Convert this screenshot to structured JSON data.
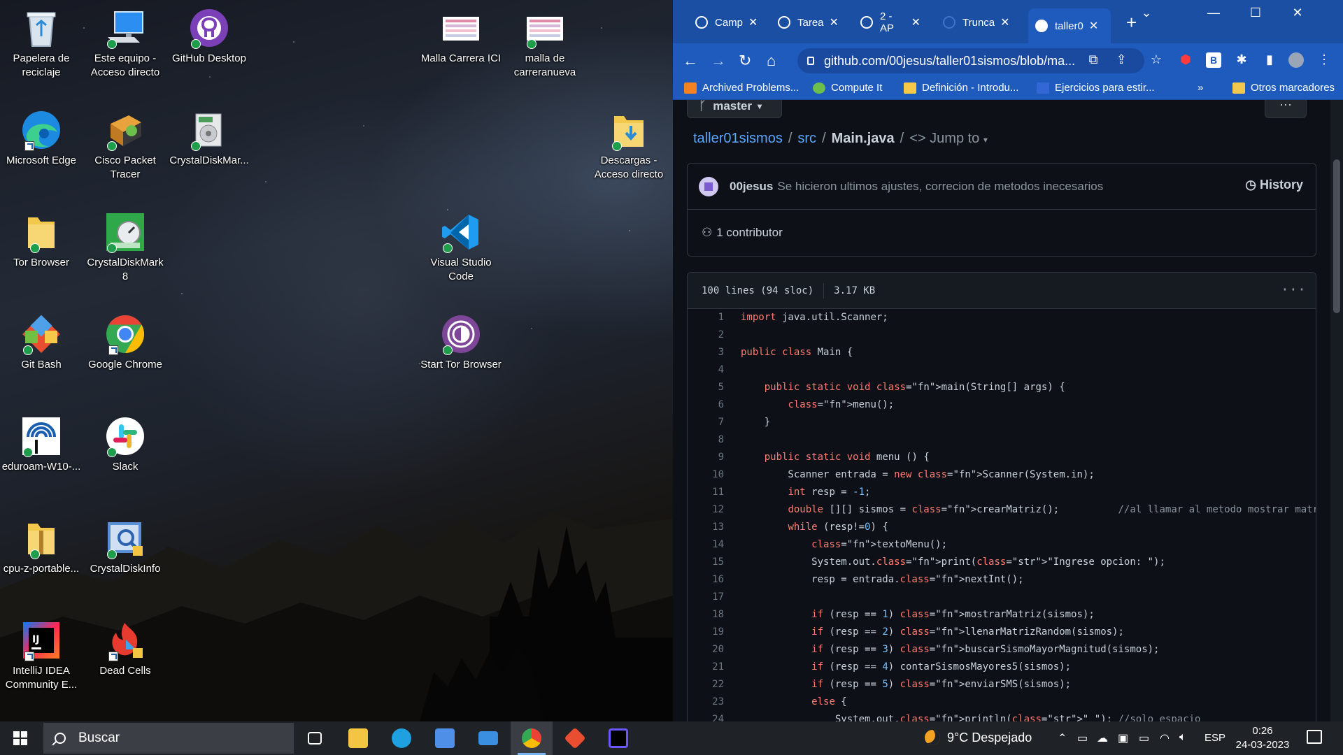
{
  "desktop": {
    "icons": [
      {
        "label": "Papelera de reciclaje",
        "icon": "recycle-bin-icon"
      },
      {
        "label": "Este equipo - Acceso directo",
        "icon": "computer-icon"
      },
      {
        "label": "GitHub Desktop",
        "icon": "github-desktop-icon"
      },
      {
        "label": "Malla Carrera ICI",
        "icon": "image-file-icon"
      },
      {
        "label": "malla de carreranueva",
        "icon": "image-file-icon"
      },
      {
        "label": "Microsoft Edge",
        "icon": "edge-icon"
      },
      {
        "label": "Cisco Packet Tracer",
        "icon": "packet-tracer-icon"
      },
      {
        "label": "CrystalDiskMar...",
        "icon": "crystaldiskmark-installer-icon"
      },
      {
        "label": "Descargas - Acceso directo",
        "icon": "downloads-folder-icon"
      },
      {
        "label": "Tor Browser",
        "icon": "folder-icon"
      },
      {
        "label": "CrystalDiskMark 8",
        "icon": "crystaldiskmark-icon"
      },
      {
        "label": "Visual Studio Code",
        "icon": "vscode-icon"
      },
      {
        "label": "Git Bash",
        "icon": "git-bash-icon"
      },
      {
        "label": "Google Chrome",
        "icon": "chrome-icon"
      },
      {
        "label": "Start Tor Browser",
        "icon": "tor-browser-icon"
      },
      {
        "label": "eduroam-W10-...",
        "icon": "eduroam-icon"
      },
      {
        "label": "Slack",
        "icon": "slack-icon"
      },
      {
        "label": "cpu-z-portable...",
        "icon": "zip-folder-icon"
      },
      {
        "label": "CrystalDiskInfo",
        "icon": "crystaldiskinfo-icon"
      },
      {
        "label": "IntelliJ IDEA Community E...",
        "icon": "intellij-icon"
      },
      {
        "label": "Dead Cells",
        "icon": "dead-cells-icon"
      }
    ]
  },
  "browser": {
    "tabs": [
      {
        "label": "Camp",
        "active": false
      },
      {
        "label": "Tarea",
        "active": false
      },
      {
        "label": "2 - AP",
        "active": false
      },
      {
        "label": "Trunca",
        "active": false
      },
      {
        "label": "taller0",
        "active": true
      }
    ],
    "new_tab_label": "+",
    "window_controls": {
      "minimize": "—",
      "maximize": "☐",
      "close": "✕"
    },
    "url": "github.com/00jesus/taller01sismos/blob/ma...",
    "bookmarks": [
      {
        "label": "Archived Problems...",
        "icon": "pe-icon",
        "color": "#f58220"
      },
      {
        "label": "Compute It",
        "icon": "compute-it-icon",
        "color": "#6cc04a"
      },
      {
        "label": "Definición - Introdu...",
        "icon": "python-icon",
        "color": "#f7c948"
      },
      {
        "label": "Ejercicios para estir...",
        "icon": "e-icon",
        "color": "#3367d6"
      }
    ],
    "bookmarks_overflow": "»",
    "other_bookmarks": "Otros marcadores"
  },
  "github": {
    "branch": "master",
    "repo": "taller01sismos",
    "folder": "src",
    "file": "Main.java",
    "jump_to": "Jump to",
    "commit_author": "00jesus",
    "commit_message": "Se hicieron ultimos ajustes, correcion de metodos inecesarios",
    "history_label": "History",
    "contributors": "1 contributor",
    "file_lines": "100 lines (94 sloc)",
    "file_size": "3.17 KB",
    "code": [
      "import java.util.Scanner;",
      "",
      "public class Main {",
      "",
      "    public static void main(String[] args) {",
      "        menu();",
      "    }",
      "",
      "    public static void menu () {",
      "        Scanner entrada = new Scanner(System.in);",
      "        int resp = -1;",
      "        double [][] sismos = crearMatriz();          //al llamar al metodo mostrar matriz, se muestr",
      "        while (resp!=0) {",
      "            textoMenu();",
      "            System.out.print(\"Ingrese opcion: \");",
      "            resp = entrada.nextInt();",
      "",
      "            if (resp == 1) mostrarMatriz(sismos);",
      "            if (resp == 2) llenarMatrizRandom(sismos);",
      "            if (resp == 3) buscarSismoMayorMagnitud(sismos);",
      "            if (resp == 4) contarSismosMayores5(sismos);",
      "            if (resp == 5) enviarSMS(sismos);",
      "            else {",
      "                System.out.println(\" \"); //solo espacio"
    ]
  },
  "taskbar": {
    "search_placeholder": "Buscar",
    "weather": "9°C Despejado",
    "language": "ESP",
    "time": "0:26",
    "date": "24-03-2023",
    "apps": [
      {
        "name": "task-view-icon",
        "color": "#ffffff"
      },
      {
        "name": "file-explorer-icon",
        "color": "#f4c542"
      },
      {
        "name": "edge-icon",
        "color": "#1fa0e0"
      },
      {
        "name": "microsoft-store-icon",
        "color": "#4f8fe8"
      },
      {
        "name": "mail-icon",
        "color": "#3a8fe0"
      },
      {
        "name": "chrome-icon",
        "color": "#e94235"
      },
      {
        "name": "git-icon",
        "color": "#e94e31"
      },
      {
        "name": "intellij-icon",
        "color": "#6b57ff"
      }
    ]
  }
}
